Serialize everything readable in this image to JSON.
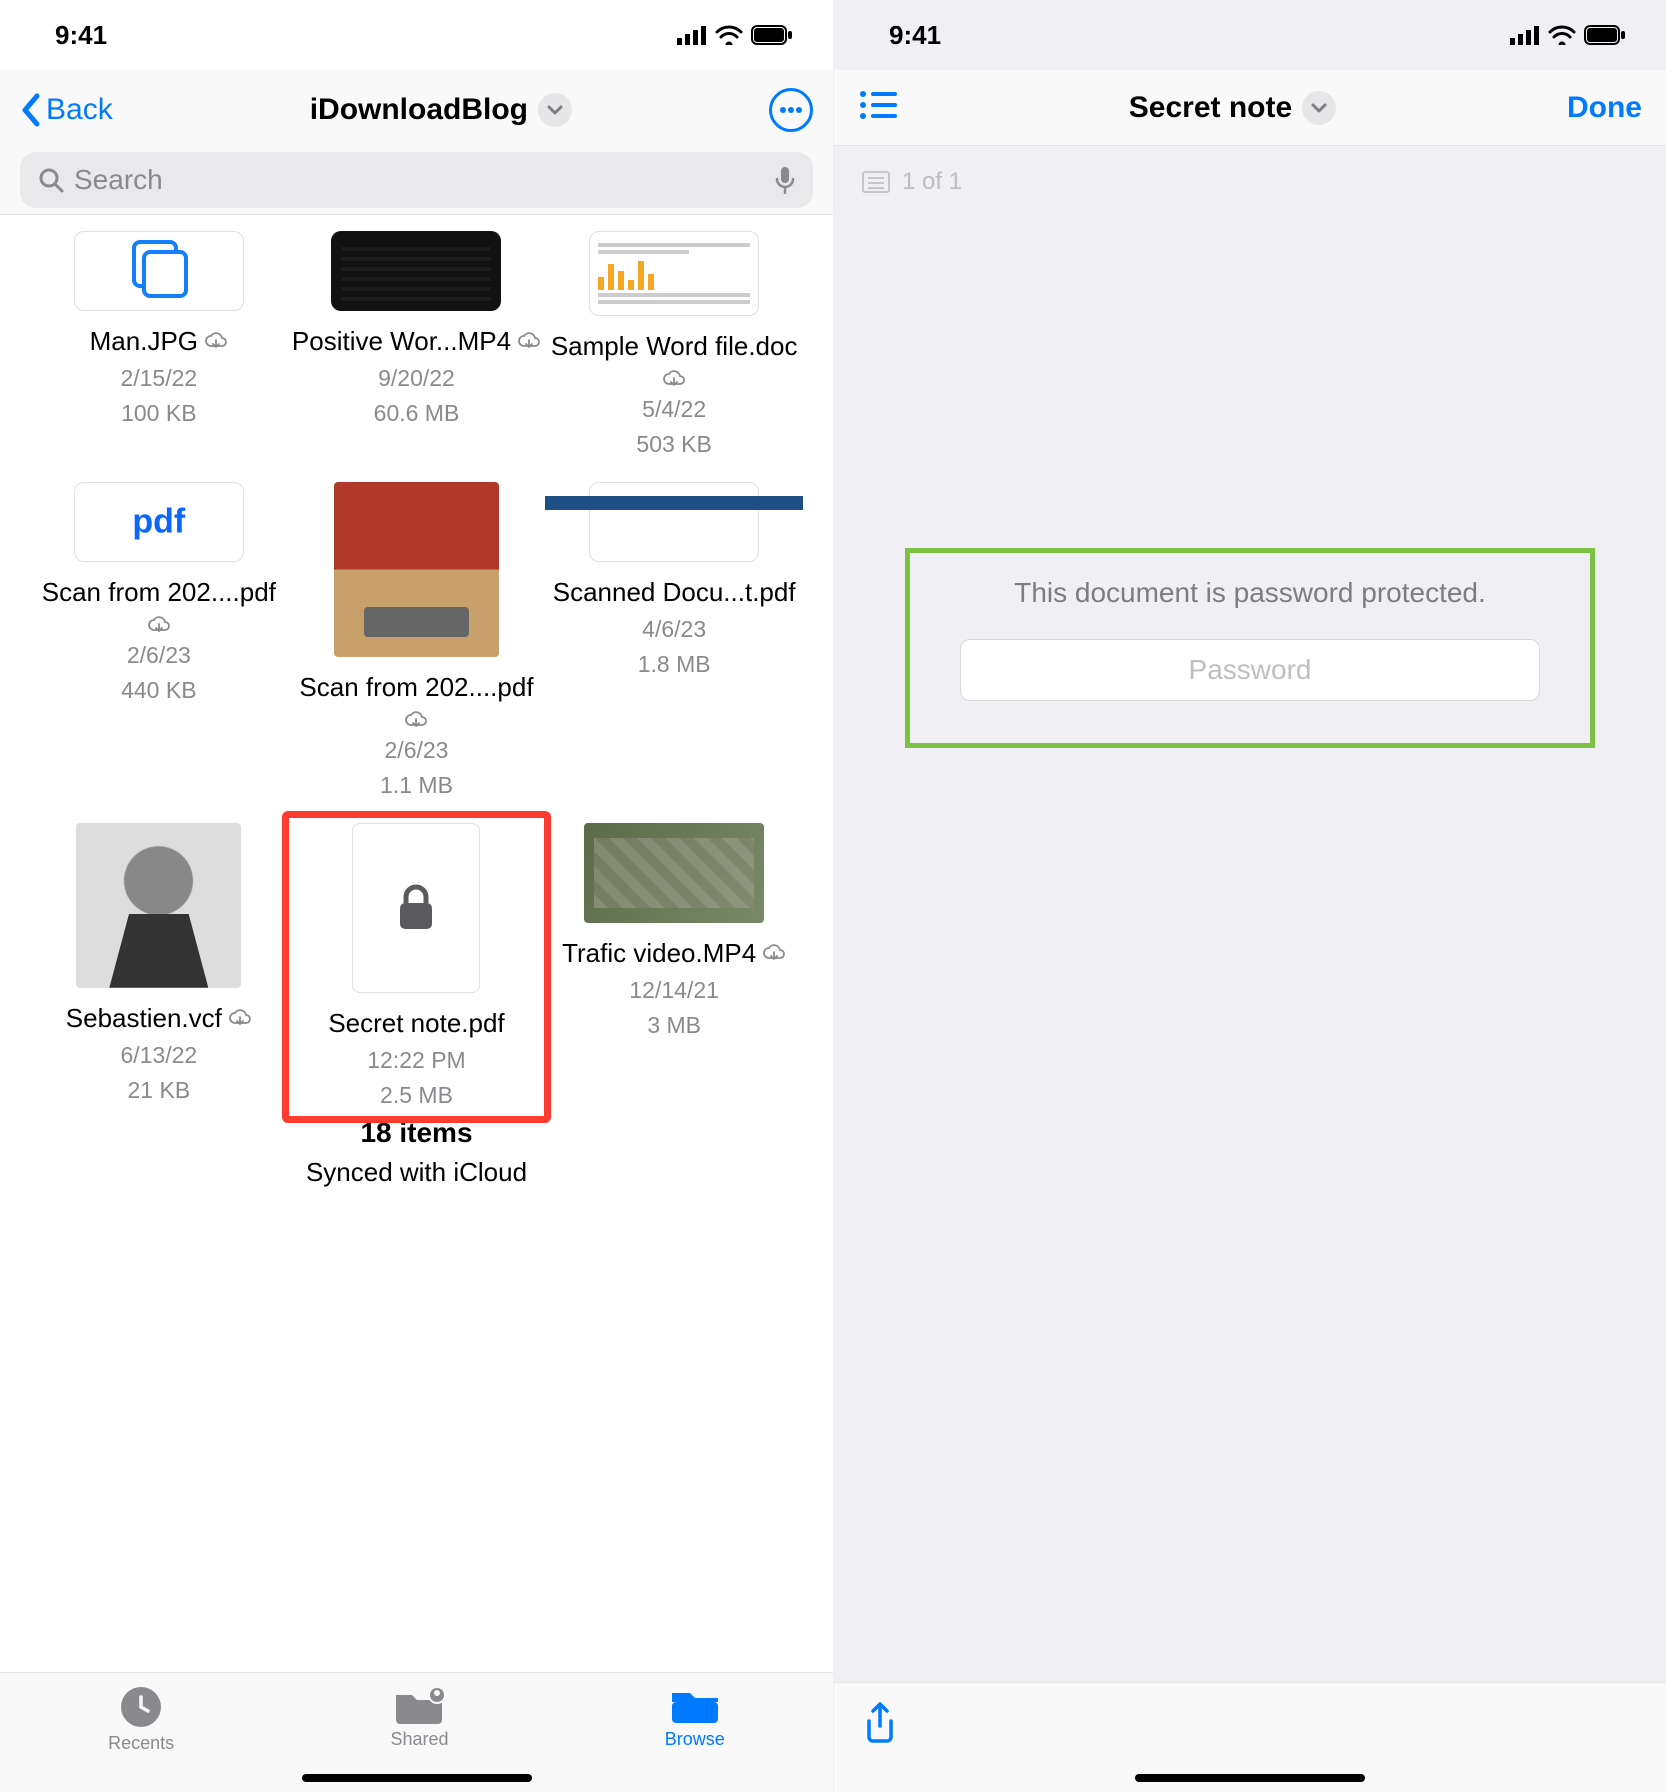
{
  "status": {
    "time": "9:41"
  },
  "left": {
    "back": "Back",
    "title": "iDownloadBlog",
    "search_placeholder": "Search",
    "files": [
      {
        "name": "Man.JPG",
        "date": "2/15/22",
        "size": "100 KB",
        "cloud": true,
        "thumb": "copies"
      },
      {
        "name": "Positive Wor...MP4",
        "date": "9/20/22",
        "size": "60.6 MB",
        "cloud": true,
        "thumb": "dark"
      },
      {
        "name": "Sample Word file.doc",
        "date": "5/4/22",
        "size": "503 KB",
        "cloud": true,
        "thumb": "doc"
      },
      {
        "name": "Scan from 202....pdf",
        "date": "2/6/23",
        "size": "440 KB",
        "cloud": true,
        "thumb": "pdficon"
      },
      {
        "name": "Scan from 202....pdf",
        "date": "2/6/23",
        "size": "1.1 MB",
        "cloud": true,
        "thumb": "photo1"
      },
      {
        "name": "Scanned Docu...t.pdf",
        "date": "4/6/23",
        "size": "1.8 MB",
        "cloud": false,
        "thumb": "card"
      },
      {
        "name": "Sebastien.vcf",
        "date": "6/13/22",
        "size": "21 KB",
        "cloud": true,
        "thumb": "portrait"
      },
      {
        "name": "Secret note.pdf",
        "date": "12:22 PM",
        "size": "2.5 MB",
        "cloud": false,
        "thumb": "lock",
        "highlight": true
      },
      {
        "name": "Trafic video.MP4",
        "date": "12/14/21",
        "size": "3 MB",
        "cloud": true,
        "thumb": "aerial"
      }
    ],
    "summary_count": "18 items",
    "summary_sync": "Synced with iCloud",
    "tabs": {
      "recents": "Recents",
      "shared": "Shared",
      "browse": "Browse"
    }
  },
  "right": {
    "title": "Secret note",
    "done": "Done",
    "page_label": "1 of 1",
    "locked_msg": "This document is password protected.",
    "password_placeholder": "Password"
  }
}
